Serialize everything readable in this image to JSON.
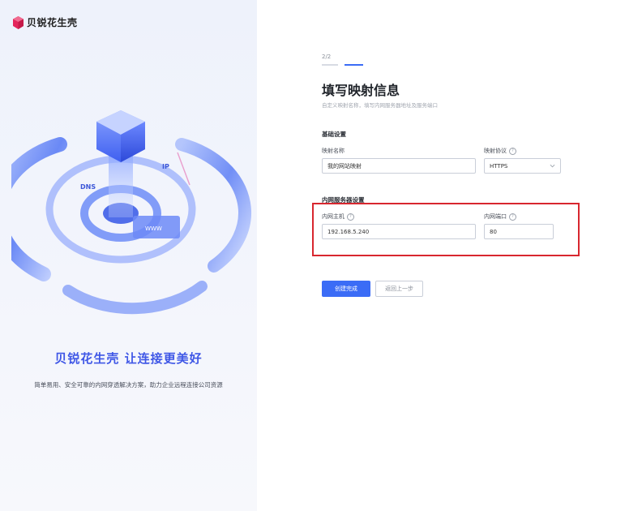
{
  "brand": {
    "name": "贝锐花生壳"
  },
  "hero": {
    "slogan": "贝锐花生壳 让连接更美好",
    "description": "简单易用、安全可靠的内网穿透解决方案，助力企业远程连接公司资源",
    "decor_labels": {
      "www": "WWW",
      "ip": "IP",
      "dns": "DNS"
    }
  },
  "form": {
    "step": "2/2",
    "title": "填写映射信息",
    "subtitle": "自定义映射名称，填写内网服务器地址及服务端口",
    "basic_section": "基础设置",
    "mapping_name_label": "映射名称",
    "mapping_name_value": "我的网站映射",
    "protocol_label": "映射协议",
    "protocol_value": "HTTPS",
    "server_section": "内网服务器设置",
    "host_label": "内网主机",
    "host_value": "192.168.5.240",
    "port_label": "内网端口",
    "port_value": "80",
    "help_glyph": "?",
    "submit_label": "创建完成",
    "back_label": "返回上一步"
  },
  "colors": {
    "accent": "#3b6cf6",
    "highlight_border": "#d8272f",
    "hero_blue": "#5b7df5"
  }
}
